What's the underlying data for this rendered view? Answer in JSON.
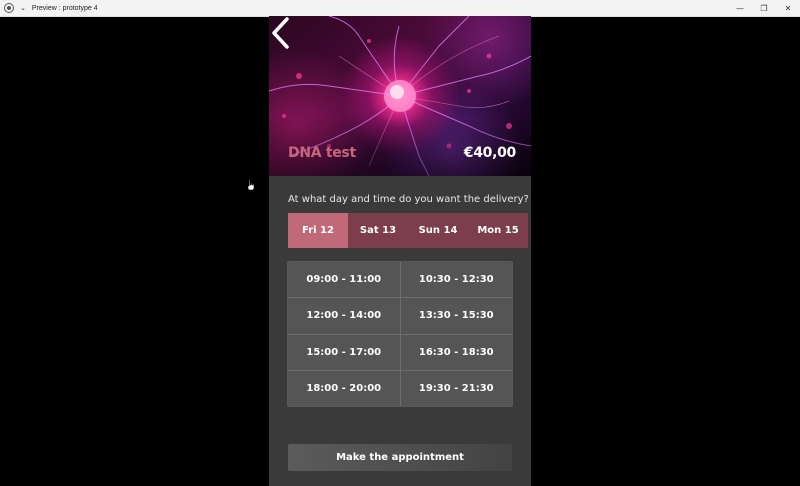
{
  "window": {
    "title": "Preview : prototype 4",
    "controls": {
      "minimize": "—",
      "restore": "❐",
      "close": "✕"
    }
  },
  "hero": {
    "back_icon": "chevron-left-icon",
    "product_name": "DNA test",
    "price": "€40,00"
  },
  "delivery": {
    "question": "At what day and time do you want the delivery?",
    "days": [
      {
        "label": "Fri 12",
        "selected": true
      },
      {
        "label": "Sat 13",
        "selected": false
      },
      {
        "label": "Sun 14",
        "selected": false
      },
      {
        "label": "Mon 15",
        "selected": false
      }
    ],
    "slots": [
      "09:00 - 11:00",
      "10:30 - 12:30",
      "12:00 - 14:00",
      "13:30 - 15:30",
      "15:00 - 17:00",
      "16:30 - 18:30",
      "18:00 - 20:00",
      "19:30 - 21:30"
    ]
  },
  "cta_label": "Make the appointment",
  "colors": {
    "accent_selected": "#c06a79",
    "accent_day": "#7b3e4a",
    "product_name": "#c6667a",
    "panel": "#3a3a3a",
    "slot": "#555555"
  }
}
